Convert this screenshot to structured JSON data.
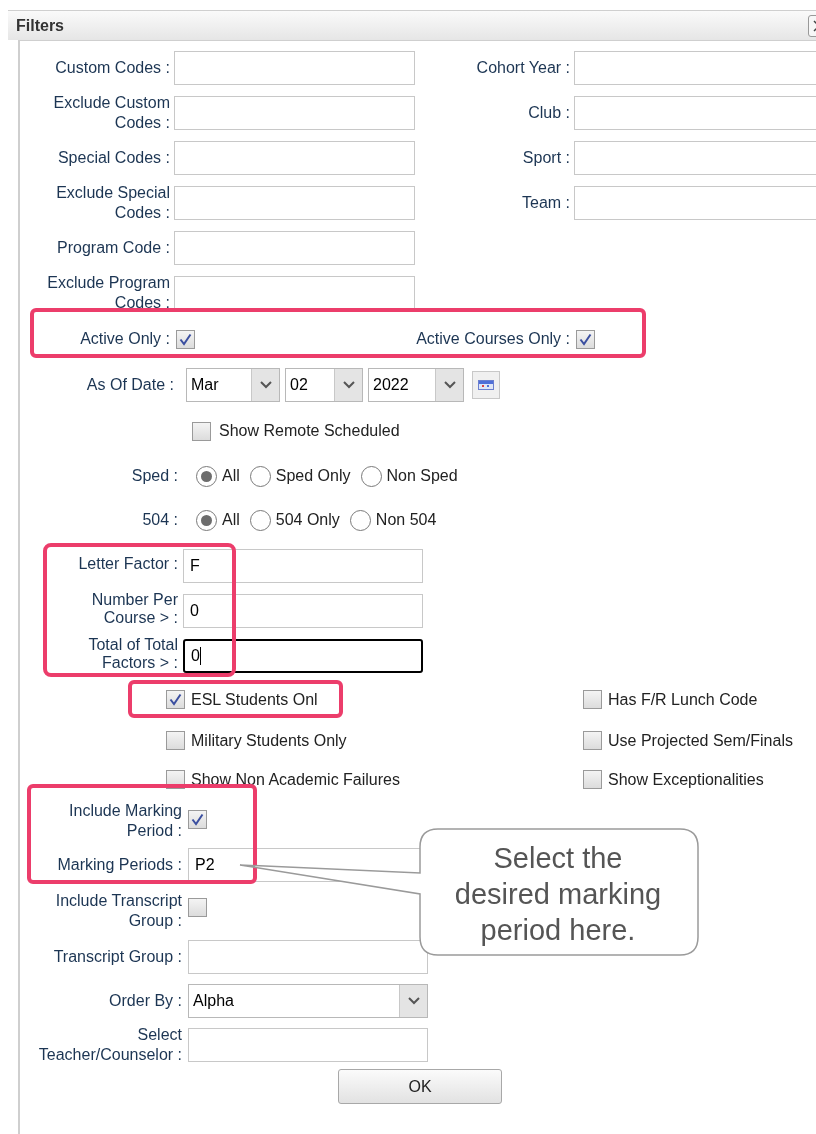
{
  "window": {
    "title": "Filters"
  },
  "code_fields_left": [
    {
      "label": "Custom Codes :"
    },
    {
      "label": "Exclude Custom Codes :"
    },
    {
      "label": "Special Codes :"
    },
    {
      "label": "Exclude Special Codes :"
    },
    {
      "label": "Program Code :"
    },
    {
      "label": "Exclude Program Codes :"
    }
  ],
  "code_fields_right": [
    {
      "label": "Cohort Year :"
    },
    {
      "label": "Club :"
    },
    {
      "label": "Sport :"
    },
    {
      "label": "Team :"
    }
  ],
  "active_checks": [
    {
      "label": "Active Only :",
      "checked": true
    },
    {
      "label": "Active Courses Only :",
      "checked": true
    }
  ],
  "as_of_date": {
    "label": "As Of Date :",
    "selects": [
      "Mar",
      "02",
      "2022"
    ]
  },
  "remote": {
    "label": "Show Remote Scheduled",
    "checked": false
  },
  "radio_groups": [
    {
      "label": "Sped :",
      "options": [
        {
          "label": "All",
          "selected": true
        },
        {
          "label": "Sped Only",
          "selected": false
        },
        {
          "label": "Non Sped",
          "selected": false
        }
      ]
    },
    {
      "label": "504 :",
      "options": [
        {
          "label": "All",
          "selected": true
        },
        {
          "label": "504 Only",
          "selected": false
        },
        {
          "label": "Non 504",
          "selected": false
        }
      ]
    }
  ],
  "factor_fields": [
    {
      "label": "Letter Factor :",
      "value": "F",
      "focused": false
    },
    {
      "label": "Number Per Course > :",
      "value": "0",
      "focused": false
    },
    {
      "label": "Total of Total Factors > :",
      "value": "0",
      "focused": true
    }
  ],
  "option_checks": [
    {
      "label": "ESL Students Onl",
      "checked": true
    },
    {
      "label": "Has F/R Lunch Code",
      "checked": false
    },
    {
      "label": "Military Students Only",
      "checked": false
    },
    {
      "label": "Use Projected Sem/Finals",
      "checked": false
    },
    {
      "label": "Show Non Academic Failures",
      "checked": false
    },
    {
      "label": "Show Exceptionalities",
      "checked": false
    }
  ],
  "lower_fields": [
    {
      "kind": "checkbox",
      "label": "Include Marking Period :",
      "checked": true
    },
    {
      "kind": "text",
      "label": "Marking Periods :",
      "value": "P2"
    },
    {
      "kind": "checkbox",
      "label": "Include Transcript Group :",
      "checked": false
    },
    {
      "kind": "text",
      "label": "Transcript Group :"
    },
    {
      "kind": "select",
      "label": "Order By :",
      "value": "Alpha"
    },
    {
      "kind": "text",
      "label": "Select Teacher/Counselor :"
    }
  ],
  "ok_button": "OK",
  "callout": "Select the desired marking period here."
}
